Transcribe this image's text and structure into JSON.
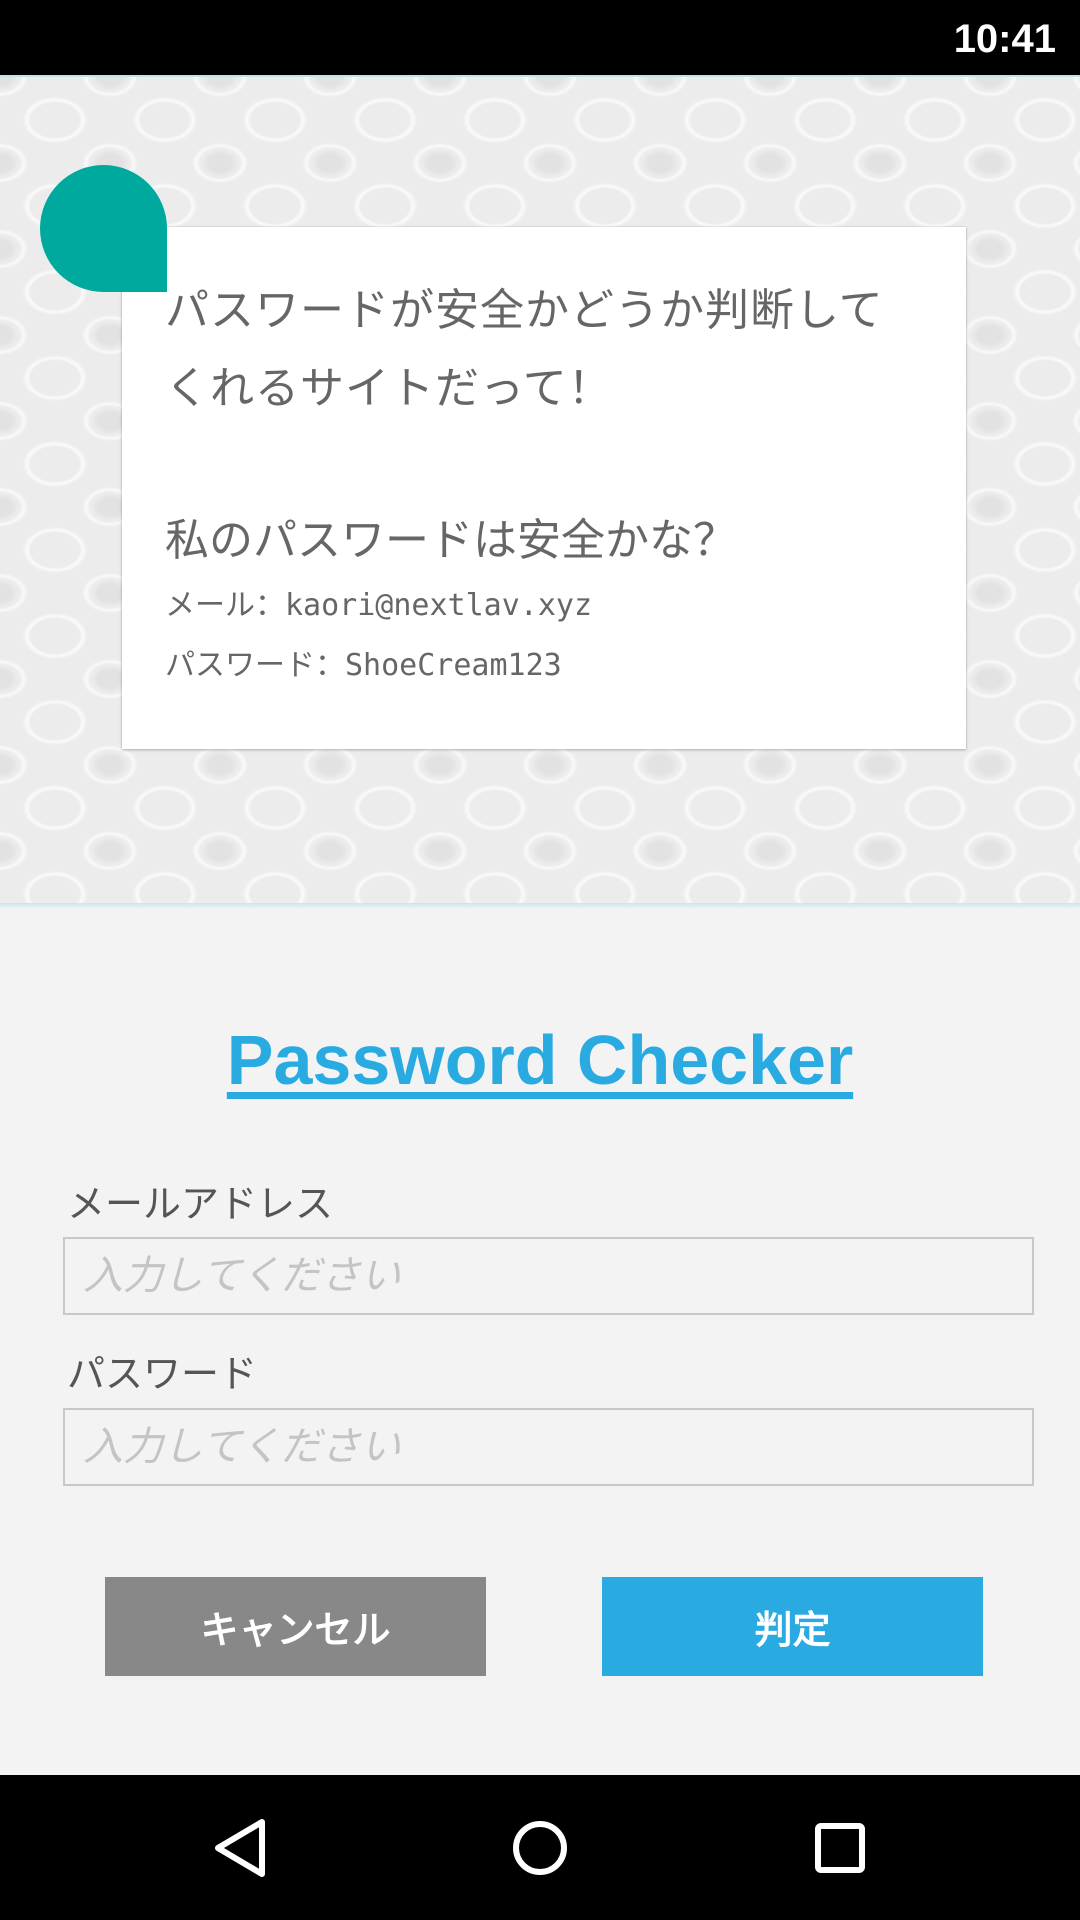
{
  "status_bar": {
    "time": "10:41"
  },
  "speech_card": {
    "line1": "パスワードが安全かどうか判断して",
    "line2": "くれるサイトだって！",
    "question": "私のパスワードは安全かな？",
    "mail_line": "メール：kaori@nextlav.xyz",
    "password_line": "パスワード：ShoeCream123"
  },
  "form": {
    "title": "Password Checker",
    "email_label": "メールアドレス",
    "email_placeholder": "入力してください",
    "email_value": "",
    "password_label": "パスワード",
    "password_placeholder": "入力してください",
    "password_value": "",
    "cancel_label": "キャンセル",
    "submit_label": "判定"
  },
  "nav_bar": {
    "icons": [
      "back-icon",
      "home-icon",
      "recents-icon"
    ]
  },
  "colors": {
    "accent": "#29abe2",
    "avatar": "#00a99d",
    "cancel": "#888888"
  }
}
